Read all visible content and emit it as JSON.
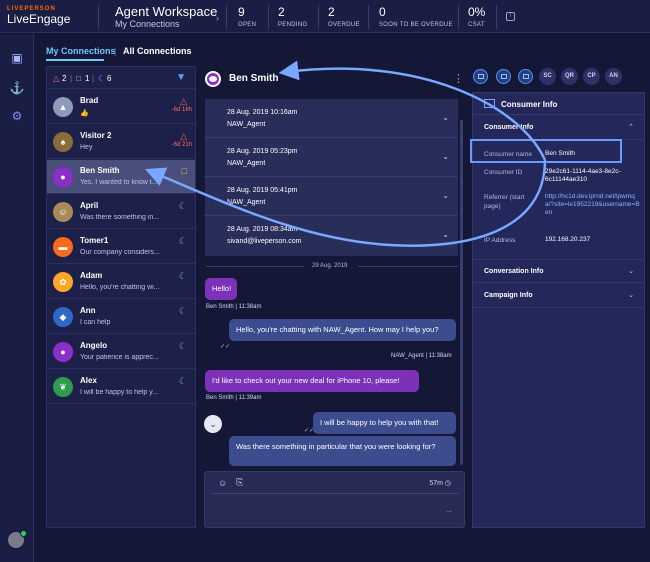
{
  "app": {
    "brand_small": "LIVEPERSON",
    "brand_big": "LiveEngage"
  },
  "workspace": {
    "title": "Agent Workspace",
    "subtitle": "My Connections"
  },
  "metrics": [
    {
      "value": "9",
      "label": "OPEN"
    },
    {
      "value": "2",
      "label": "PENDING"
    },
    {
      "value": "2",
      "label": "OVERDUE"
    },
    {
      "value": "0",
      "label": "SOON TO BE OVERDUE"
    },
    {
      "value": "0%",
      "label": "CSAT"
    }
  ],
  "tabs": [
    {
      "label": "My Connections"
    },
    {
      "label": "All Connections"
    }
  ],
  "list_header": {
    "alerts": "2",
    "chats": "1",
    "away": "6"
  },
  "conversations": [
    {
      "name": "Brad",
      "message": "👍",
      "time": "-6d 16h",
      "status": "alert",
      "avatar_color": "#8d9bb8"
    },
    {
      "name": "Visitor 2",
      "message": "Hey",
      "time": "-6d 21h",
      "status": "alert",
      "avatar_color": "#8a6b3a"
    },
    {
      "name": "Ben Smith",
      "message": "Yes. I wanted to know t...",
      "time": "",
      "status": "chat",
      "avatar_color": "#8b2fc9"
    },
    {
      "name": "April",
      "message": "Was there something in...",
      "time": "",
      "status": "away",
      "avatar_color": "#a88a5a"
    },
    {
      "name": "Tomer1",
      "message": "Our company considers...",
      "time": "",
      "status": "away",
      "avatar_color": "#ff6a1a"
    },
    {
      "name": "Adam",
      "message": "Hello, you're chatting wi...",
      "time": "",
      "status": "away",
      "avatar_color": "#ffa726"
    },
    {
      "name": "Ann",
      "message": "I can help",
      "time": "",
      "status": "away",
      "avatar_color": "#2f69c7"
    },
    {
      "name": "Angelo",
      "message": "Your patience is apprec...",
      "time": "",
      "status": "away",
      "avatar_color": "#8b2fc9"
    },
    {
      "name": "Alex",
      "message": "I will be happy to help y...",
      "time": "",
      "status": "away",
      "avatar_color": "#2e9b4d"
    }
  ],
  "chat": {
    "contact_name": "Ben Smith",
    "history": [
      {
        "date": "28 Aug. 2019 10:16am",
        "agent": "NAW_Agent"
      },
      {
        "date": "28 Aug. 2019 05:23pm",
        "agent": "NAW_Agent"
      },
      {
        "date": "28 Aug. 2019 05:41pm",
        "agent": "NAW_Agent"
      },
      {
        "date": "28 Aug. 2019 08:34am",
        "agent": "sivand@liveperson.com"
      }
    ],
    "day_separator": "29 Aug. 2019",
    "messages": [
      {
        "from": "consumer",
        "text": "Hello!",
        "meta": "Ben Smith | 11:38am"
      },
      {
        "from": "agent",
        "text": "Hello, you're chatting with NAW_Agent. How may I help you?",
        "meta": "NAW_Agent | 11:38am"
      },
      {
        "from": "consumer",
        "text": "I'd like to check out your new deal for iPhone 10, please!",
        "meta": "Ben Smith | 11:39am"
      },
      {
        "from": "agent",
        "text": "I will be happy to help you with that!",
        "meta": ""
      },
      {
        "from": "agent",
        "text": "Was there something in particular that you were looking for?",
        "meta": ""
      }
    ],
    "composer_timer": "57m"
  },
  "right_toolbar": [
    "SC",
    "QR",
    "CP",
    "AN"
  ],
  "consumer_panel": {
    "title": "Consumer Info",
    "section_title": "Consumer Info",
    "fields": [
      {
        "label": "Consumer name",
        "value": "Ben Smith"
      },
      {
        "label": "Consumer ID",
        "value": "29e2c61-1114-4ae3-8e2c-6c11144ae310"
      },
      {
        "label": "Referrer (start page)",
        "value": "http://hc1d.dev.lprnd.net/lpwmqa/?site=le1952219&username=Ben"
      },
      {
        "label": "IP Address",
        "value": "192.168.20.237"
      }
    ],
    "collapsed_sections": [
      "Conversation Info",
      "Campaign Info"
    ]
  }
}
